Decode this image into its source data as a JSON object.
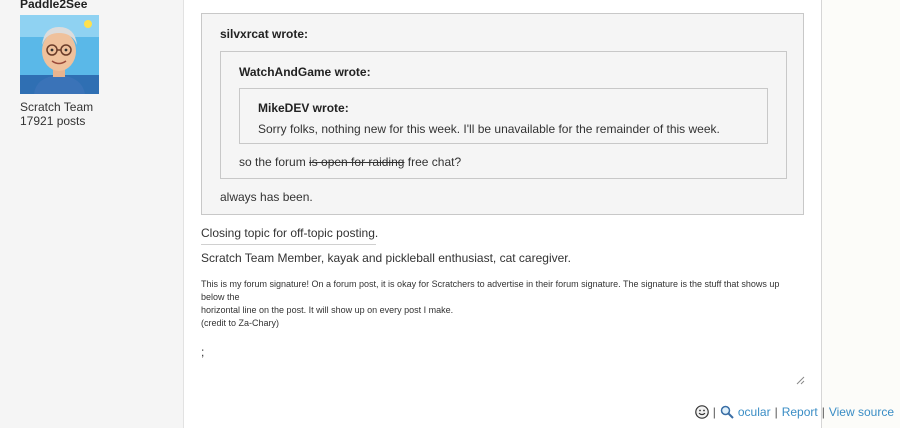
{
  "poster": {
    "username": "Paddle2See",
    "title": "Scratch Team",
    "post_count": "17921 posts"
  },
  "quotes": {
    "outer_author": "silvxrcat wrote:",
    "outer_reply": "always has been.",
    "middle_author": "WatchAndGame wrote:",
    "middle_text_before": "so the forum ",
    "middle_text_struck": "is open for raiding",
    "middle_text_after": " free chat?",
    "inner_author": "MikeDEV wrote:",
    "inner_text": "Sorry folks, nothing new for this week. I'll be unavailable for the remainder of this week."
  },
  "post": {
    "body": "Closing topic for off-topic posting."
  },
  "signature": {
    "line1": "Scratch Team Member, kayak and pickleball enthusiast, cat caregiver.",
    "small_line1": "This is my forum signature! On a forum post, it is okay for Scratchers to advertise in their forum signature. The signature is the stuff that shows up below the",
    "small_line2": "horizontal line on the post. It will show up on every post I make.",
    "small_line3": "(credit to Za-Chary)",
    "semicolon": ";"
  },
  "actions": {
    "separator": "|",
    "ocular": "ocular",
    "report": "Report",
    "view_source": "View source"
  },
  "icons": {
    "smile": "smile-icon",
    "magnifier": "magnifier-icon"
  },
  "colors": {
    "link": "#3a8dc5",
    "quote_bg": "#f5f5f5",
    "sidebar_bg": "#f5f5f5"
  }
}
